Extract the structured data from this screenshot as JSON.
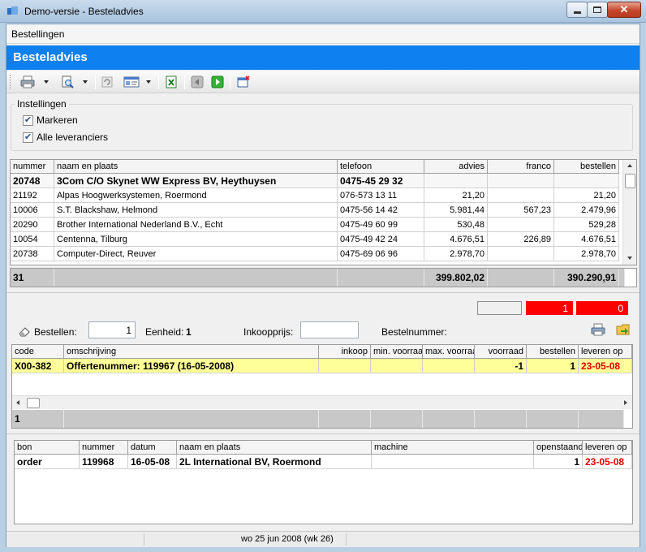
{
  "window": {
    "title": "Demo-versie - Besteladvies"
  },
  "menu": {
    "items": [
      "Bestellingen"
    ]
  },
  "banner": {
    "title": "Besteladvies"
  },
  "toolbar": {
    "icons": [
      "printer-icon",
      "preview-icon",
      "refresh-icon",
      "card-icon",
      "excel-icon",
      "back-icon",
      "play-icon",
      "new-window-icon"
    ]
  },
  "settings": {
    "group_label": "Instellingen",
    "markeren": {
      "label": "Markeren",
      "checked": true
    },
    "alle_leveranciers": {
      "label": "Alle leveranciers",
      "checked": true
    }
  },
  "suppliers": {
    "columns": [
      "nummer",
      "naam en plaats",
      "telefoon",
      "advies",
      "franco",
      "bestellen"
    ],
    "rows": [
      {
        "nummer": "20748",
        "naam": "3Com C/O Skynet WW Express BV, Heythuysen",
        "telefoon": "0475-45 29 32",
        "advies": "",
        "franco": "",
        "bestellen": "",
        "bold": true
      },
      {
        "nummer": "21192",
        "naam": "Alpas Hoogwerksystemen, Roermond",
        "telefoon": "076-573 13 11",
        "advies": "21,20",
        "franco": "",
        "bestellen": "21,20"
      },
      {
        "nummer": "10006",
        "naam": "S.T. Blackshaw, Helmond",
        "telefoon": "0475-56 14 42",
        "advies": "5.981,44",
        "franco": "567,23",
        "bestellen": "2.479,96"
      },
      {
        "nummer": "20290",
        "naam": "Brother International Nederland B.V., Echt",
        "telefoon": "0475-49 60 99",
        "advies": "530,48",
        "franco": "",
        "bestellen": "529,28"
      },
      {
        "nummer": "10054",
        "naam": "Centenna, Tilburg",
        "telefoon": "0475-49 42 24",
        "advies": "4.676,51",
        "franco": "226,89",
        "bestellen": "4.676,51"
      },
      {
        "nummer": "20738",
        "naam": "Computer-Direct, Reuver",
        "telefoon": "0475-69 06 96",
        "advies": "2.978,70",
        "franco": "",
        "bestellen": "2.978,70"
      }
    ],
    "totals": {
      "count": "31",
      "advies": "399.802,02",
      "bestellen": "390.290,91"
    }
  },
  "indicators": {
    "blank": "",
    "red1": "1",
    "red2": "0"
  },
  "order_form": {
    "bestellen_label": "Bestellen:",
    "bestellen_value": "1",
    "eenheid_label": "Eenheid:",
    "eenheid_value": "1",
    "inkoopprijs_label": "Inkoopprijs:",
    "inkoopprijs_value": "",
    "bestelnummer_label": "Bestelnummer:"
  },
  "articles": {
    "columns": [
      "code",
      "omschrijving",
      "inkoop",
      "min. voorraad",
      "max. voorraad",
      "voorraad",
      "bestellen",
      "leveren op"
    ],
    "rows": [
      {
        "code": "X00-382",
        "omschrijving": "Offertenummer: 119967 (16-05-2008)",
        "inkoop": "",
        "min": "",
        "max": "",
        "voorraad": "-1",
        "bestellen": "1",
        "leveren_op": "23-05-08"
      }
    ],
    "totals": {
      "count": "1"
    }
  },
  "orders": {
    "columns": [
      "bon",
      "nummer",
      "datum",
      "naam en plaats",
      "machine",
      "openstaand",
      "leveren op"
    ],
    "rows": [
      {
        "bon": "order",
        "nummer": "119968",
        "datum": "16-05-08",
        "naam": "2L International BV, Roermond",
        "machine": "",
        "openstaand": "1",
        "leveren_op": "23-05-08"
      }
    ]
  },
  "status": {
    "text": "wo 25 jun 2008 (wk 26)"
  },
  "colors": {
    "banner": "#0f80f0",
    "highlight": "#ffff99",
    "indicator_red": "#ff0000",
    "late_red": "#e00000"
  }
}
